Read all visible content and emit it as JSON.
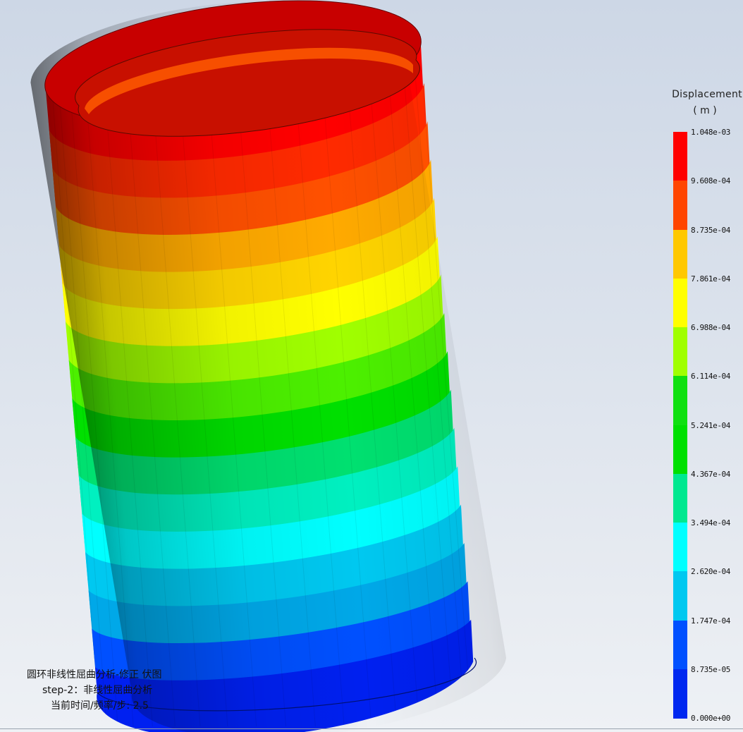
{
  "legend": {
    "title": "Displacement",
    "unit": "( m )",
    "ticks": [
      "1.048e-03",
      "9.608e-04",
      "8.735e-04",
      "7.861e-04",
      "6.988e-04",
      "6.114e-04",
      "5.241e-04",
      "4.367e-04",
      "3.494e-04",
      "2.620e-04",
      "1.747e-04",
      "8.735e-05",
      "0.000e+00"
    ],
    "colors": [
      "#ff0000",
      "#ff4500",
      "#ffc800",
      "#ffff00",
      "#a0ff00",
      "#10e010",
      "#00e000",
      "#00e890",
      "#00ffff",
      "#00c8f0",
      "#0050ff",
      "#0028f0"
    ]
  },
  "caption": {
    "line1": "圆环非线性屈曲分析-修正  伏图",
    "line2": "step-2：非线性屈曲分析",
    "line3": "当前时间/频率/步: 2.5"
  },
  "model": {
    "band_colors": [
      "#ff0000",
      "#ff2a00",
      "#ff5000",
      "#ffaa00",
      "#ffd400",
      "#ffff00",
      "#a0ff00",
      "#4cf000",
      "#00e000",
      "#00e070",
      "#00f0c0",
      "#00ffff",
      "#00c8f0",
      "#00a8e8",
      "#0050ff",
      "#0020f0"
    ]
  }
}
